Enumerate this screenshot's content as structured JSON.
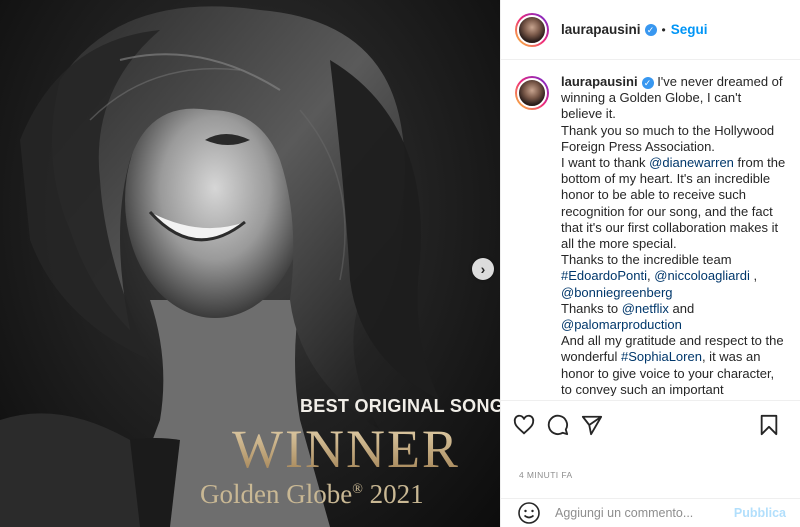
{
  "post_image": {
    "line1": "BEST ORIGINAL SONG",
    "line2": "WINNER",
    "line3": "Golden Globe",
    "line3_mark": "®",
    "line3_year": "2021"
  },
  "header": {
    "username": "laurapausini",
    "dot": "•",
    "follow_label": "Segui"
  },
  "caption": {
    "username": "laurapausini",
    "t1": " I've never dreamed of winning a Golden Globe, I can't believe it.",
    "t2": "Thank you so much to the Hollywood Foreign Press Association.",
    "t3a": "I want to thank ",
    "m1": "@dianewarren",
    "t3b": " from the bottom of my heart. It's an incredible honor to be able to receive such recognition for our song, and the fact that it's our first collaboration makes it all the more special.",
    "t4": "Thanks to the incredible team",
    "m2": "#EdoardoPonti",
    "t5": ", ",
    "m3": "@niccoloagliardi",
    "t6": " , ",
    "m4": "@bonniegreenberg",
    "t7": "Thanks to ",
    "m5": "@netflix",
    "t8": " and",
    "m6": "@palomarproduction",
    "t9a": "And all my gratitude and respect to the wonderful ",
    "m7": "#SophiaLoren",
    "t9b": ", it was an honor to give voice to your character, to convey such an important"
  },
  "meta": {
    "timestamp": "4 MINUTI FA"
  },
  "comment_box": {
    "placeholder": "Aggiungi un commento...",
    "publish_label": "Pubblica"
  },
  "colors": {
    "accent": "#0095f6",
    "link": "#00376b",
    "muted": "#8e8e8e",
    "publish_disabled": "#b2dffc",
    "verified": "#3897f0"
  },
  "icons": [
    "chevron-right-icon",
    "verified-icon",
    "heart-icon",
    "comment-icon",
    "share-icon",
    "bookmark-icon",
    "emoji-icon"
  ]
}
